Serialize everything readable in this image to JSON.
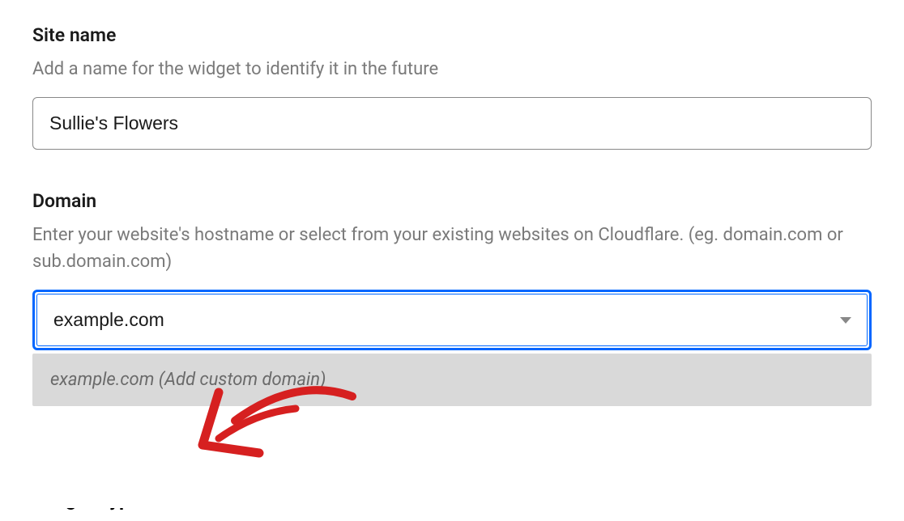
{
  "siteName": {
    "label": "Site name",
    "description": "Add a name for the widget to identify it in the future",
    "value": "Sullie's Flowers"
  },
  "domain": {
    "label": "Domain",
    "description": "Enter your website's hostname or select from your existing websites on Cloudflare. (eg. domain.com or sub.domain.com)",
    "value": "example.com",
    "dropdownOption": "example.com (Add custom domain)"
  },
  "cutoff": {
    "label": "Widget Type"
  },
  "annotation": {
    "color": "#d62020"
  }
}
